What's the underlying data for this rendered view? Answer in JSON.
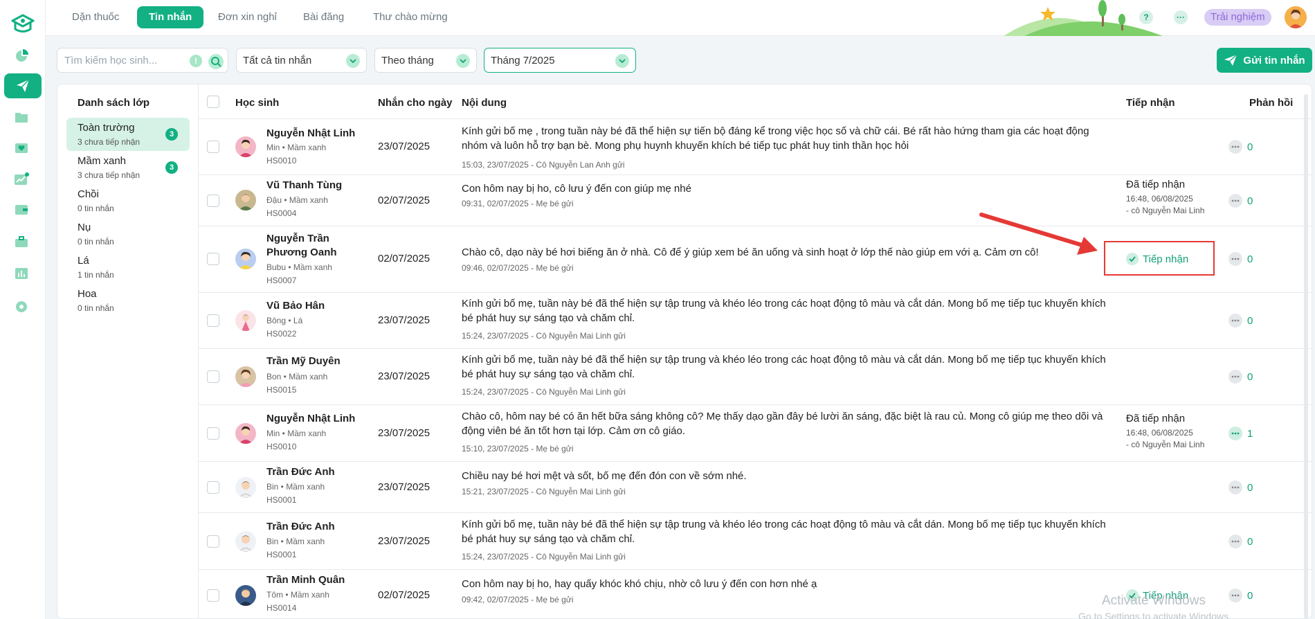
{
  "nav": {
    "tabs": [
      {
        "label": "Dặn thuốc"
      },
      {
        "label": "Tin nhắn"
      },
      {
        "label": "Đơn xin nghỉ"
      },
      {
        "label": "Bài đăng"
      },
      {
        "label": "Thư chào mừng"
      }
    ],
    "trial_label": "Trải nghiệm",
    "help_label": "?",
    "more_label": "···"
  },
  "filters": {
    "search_placeholder": "Tìm kiếm học sinh...",
    "warn_label": "!",
    "type_value": "Tất cả tin nhắn",
    "period_value": "Theo tháng",
    "month_value": "Tháng 7/2025",
    "send_label": "Gửi tin nhắn"
  },
  "classes": {
    "title": "Danh sách lớp",
    "items": [
      {
        "name": "Toàn trường",
        "sub": "3 chưa tiếp nhận",
        "badge": "3"
      },
      {
        "name": "Mầm xanh",
        "sub": "3 chưa tiếp nhận",
        "badge": "3"
      },
      {
        "name": "Chồi",
        "sub": "0 tin nhắn"
      },
      {
        "name": "Nụ",
        "sub": "0 tin nhắn"
      },
      {
        "name": "Lá",
        "sub": "1 tin nhắn"
      },
      {
        "name": "Hoa",
        "sub": "0 tin nhắn"
      }
    ]
  },
  "table": {
    "headers": {
      "student": "Học sinh",
      "date": "Nhắn cho ngày",
      "content": "Nội dung",
      "receive": "Tiếp nhận",
      "reply": "Phản hồi"
    },
    "rows": [
      {
        "name": "Nguyễn Nhật Linh",
        "meta": "Min • Mầm xanh",
        "code": "HS0010",
        "date": "23/07/2025",
        "msg": "Kính gửi bố mẹ , trong tuần này bé đã thể hiện sự tiến bộ đáng kể trong việc học số và chữ cái. Bé rất hào hứng tham gia các hoạt động nhóm và luôn hỗ trợ bạn bè. Mong phụ huynh khuyến khích bé tiếp tục phát huy tinh thần học hỏi",
        "sender": "15:03, 23/07/2025 - Cô Nguyễn Lan Anh gửi",
        "reply": "0"
      },
      {
        "name": "Vũ Thanh Tùng",
        "meta": "Đậu • Mầm xanh",
        "code": "HS0004",
        "date": "02/07/2025",
        "msg": "Con hôm nay bị ho, cô lưu ý đến con giúp mẹ nhé",
        "sender": "09:31, 02/07/2025 - Mẹ bé gửi",
        "receive": "Đã tiếp nhận",
        "receive_time": "16:48, 06/08/2025",
        "receive_by": "- cô Nguyễn Mai Linh",
        "reply": "0"
      },
      {
        "name": "Nguyễn Trần Phương Oanh",
        "meta": "Bubu • Mầm xanh",
        "code": "HS0007",
        "date": "02/07/2025",
        "msg": "Chào cô, dạo này bé hơi biếng ăn ở nhà. Cô để ý giúp xem bé ăn uống và sinh hoạt ở lớp thế nào giúp em với ạ. Cảm ơn cô!",
        "sender": "09:46, 02/07/2025 - Mẹ bé gửi",
        "receive_btn": "Tiếp nhận",
        "reply": "0"
      },
      {
        "name": "Vũ Bảo Hân",
        "meta": "Bông • Lá",
        "code": "HS0022",
        "date": "23/07/2025",
        "msg": "Kính gửi bố mẹ, tuần này bé đã thể hiện sự tập trung và khéo léo trong các hoạt động tô màu và cắt dán. Mong bố mẹ tiếp tục khuyến khích bé phát huy sự sáng tạo và chăm chỉ.",
        "sender": "15:24, 23/07/2025 - Cô Nguyễn Mai Linh gửi",
        "reply": "0"
      },
      {
        "name": "Trần Mỹ Duyên",
        "meta": "Bon • Mầm xanh",
        "code": "HS0015",
        "date": "23/07/2025",
        "msg": "Kính gửi bố mẹ, tuần này bé đã thể hiện sự tập trung và khéo léo trong các hoạt động tô màu và cắt dán. Mong bố mẹ tiếp tục khuyến khích bé phát huy sự sáng tạo và chăm chỉ.",
        "sender": "15:24, 23/07/2025 - Cô Nguyễn Mai Linh gửi",
        "reply": "0"
      },
      {
        "name": "Nguyễn Nhật Linh",
        "meta": "Min • Mầm xanh",
        "code": "HS0010",
        "date": "23/07/2025",
        "msg": "Chào cô, hôm nay bé có ăn hết bữa sáng không cô? Mẹ thấy dạo gần đây bé lười ăn sáng, đặc biệt là rau củ. Mong cô giúp mẹ theo dõi và động viên bé ăn tốt hơn tại lớp. Cảm ơn cô giáo.",
        "sender": "15:10, 23/07/2025 - Mẹ bé gửi",
        "receive": "Đã tiếp nhận",
        "receive_time": "16:48, 06/08/2025",
        "receive_by": "- cô Nguyễn Mai Linh",
        "reply": "1"
      },
      {
        "name": "Trần Đức Anh",
        "meta": "Bin • Mầm xanh",
        "code": "HS0001",
        "date": "23/07/2025",
        "msg": "Chiều nay bé hơi mệt và sốt, bố mẹ đến đón con về sớm nhé.",
        "sender": "15:21, 23/07/2025 - Cô Nguyễn Mai Linh gửi",
        "reply": "0"
      },
      {
        "name": "Trần Đức Anh",
        "meta": "Bin • Mầm xanh",
        "code": "HS0001",
        "date": "23/07/2025",
        "msg": "Kính gửi bố mẹ, tuần này bé đã thể hiện sự tập trung và khéo léo trong các hoạt động tô màu và cắt dán. Mong bố mẹ tiếp tục khuyến khích bé phát huy sự sáng tạo và chăm chỉ.",
        "sender": "15:24, 23/07/2025 - Cô Nguyễn Mai Linh gửi",
        "reply": "0"
      },
      {
        "name": "Trần Minh Quân",
        "meta": "Tôm • Mầm xanh",
        "code": "HS0014",
        "date": "02/07/2025",
        "msg": "Con hôm nay bị ho, hay quấy khóc khó chịu, nhờ cô lưu ý đến con hơn nhé ạ",
        "sender": "09:42, 02/07/2025 - Mẹ bé gửi",
        "receive_btn": "Tiếp nhận",
        "reply": "0"
      }
    ]
  },
  "watermark": {
    "title": "Activate Windows",
    "sub": "Go to Settings to activate Windows."
  },
  "colors": {
    "accent": "#12b083",
    "highlight": "#e53935",
    "trial": "#d9ccf5"
  }
}
